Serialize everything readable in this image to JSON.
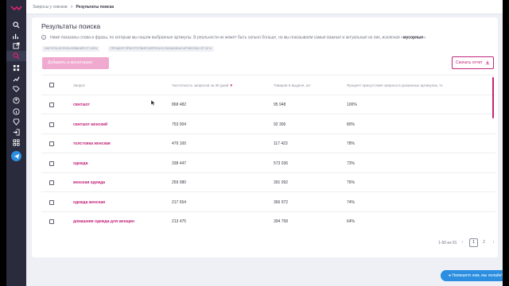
{
  "sidebar": {
    "icons": [
      "logo-icon",
      "search-icon",
      "analytics-icon",
      "external-link-icon",
      "search-active-icon",
      "grid-icon",
      "chart-icon",
      "tag-icon",
      "user-icon",
      "info-icon",
      "diamond-icon",
      "login-icon",
      "apps-icon",
      "telegram-icon"
    ]
  },
  "breadcrumb": {
    "parent": "Запросы у списков",
    "separator": ">",
    "current": "Результаты поиска"
  },
  "page": {
    "title": "Результаты поиска",
    "info_text": "Ниже показаны слова и фразы, по которым мы нашли выбранные артикулы. В реальности их может быть сильно больше, но мы показываем самые важные и актуальные из них, исключая «",
    "info_bold": "мусорные",
    "info_end": "».",
    "chip1": "ЧАСТОТА ИСПОЛЬЗОВАНИЯ ОТ 100%",
    "chip2": "ПРОЦЕНТ ПРИСУТСТВИЯ ЗАПРОСА В УКАЗАННЫХ АРТИКУЛАХ ОТ 30 %",
    "add_button": "Добавить в мониторинг",
    "download_button": "Скачать отчет"
  },
  "table": {
    "columns": [
      "Запрос",
      "Частотность запросов за 30 дней",
      "Товаров в выдаче, шт",
      "Процент присутствия запроса в указанных артикулах, %"
    ],
    "rows": [
      {
        "query": "свитшот",
        "freq": "868 482",
        "goods": "95 948",
        "pct": "100%"
      },
      {
        "query": "свитшот женский",
        "freq": "753 004",
        "goods": "92 306",
        "pct": "80%"
      },
      {
        "query": "толстовка женская",
        "freq": "479 100",
        "goods": "117 423",
        "pct": "78%"
      },
      {
        "query": "одежда",
        "freq": "338 447",
        "goods": "573 036",
        "pct": "73%"
      },
      {
        "query": "женская одежда",
        "freq": "259 080",
        "goods": "391 092",
        "pct": "76%"
      },
      {
        "query": "одежда женская",
        "freq": "217 654",
        "goods": "366 972",
        "pct": "74%"
      },
      {
        "query": "домашняя одежда для женщин",
        "freq": "213 475",
        "goods": "394 758",
        "pct": "64%"
      }
    ]
  },
  "pagination": {
    "range": "1-50 из 91",
    "prev": "‹",
    "page1": "1",
    "page2": "2",
    "next": "›"
  },
  "chat": {
    "label": "Напишите нам, мы онлайн!"
  },
  "colors": {
    "accent": "#c2257b",
    "sidebar": "#2a2b3d",
    "chat": "#2b8ee0"
  }
}
